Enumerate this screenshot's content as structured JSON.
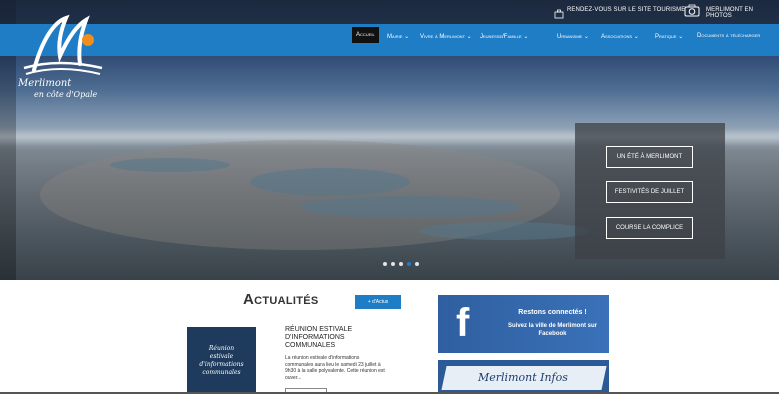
{
  "topbar": {
    "tourism_link": "RENDEZ-VOUS SUR LE SITE TOURISME",
    "photos_link": "MERLIMONT EN PHOTOS"
  },
  "logo": {
    "line1": "Merlimont",
    "line2": "en côte d'Opale"
  },
  "nav": {
    "items": [
      {
        "label": "Accueil"
      },
      {
        "label": "Mairie ⌄"
      },
      {
        "label": "Vivre à Merlimont ⌄"
      },
      {
        "label": "Jeunesse/Famille ⌄"
      },
      {
        "label": "Urbanisme ⌄"
      },
      {
        "label": "Associations ⌄"
      },
      {
        "label": "Pratique ⌄"
      },
      {
        "label": "Documents à télécharger"
      }
    ]
  },
  "hero": {
    "buttons": [
      {
        "label": "UN ÉTÉ À MERLIMONT"
      },
      {
        "label": "FESTIVITÉS DE JUILLET"
      },
      {
        "label": "COURSE LA COMPLICE"
      }
    ],
    "slide_count": 4,
    "active_slide": 4
  },
  "news": {
    "title": "Actualités",
    "more_label": "+ d'Actus",
    "item": {
      "thumb_lines": [
        "Réunion",
        "estivale",
        "d'informations",
        "communales"
      ],
      "headline": "RÉUNION ESTIVALE D'INFORMATIONS COMMUNALES",
      "excerpt": "La réunion estivale d'informations communales aura lieu le samedi 23 juillet à 9h30 à la salle polyvalente. Cette réunion est ouver..."
    }
  },
  "facebook": {
    "line1": "Restons connectés !",
    "line2": "Suivez la ville de Merlimont sur Facebook"
  },
  "infos": {
    "label": "Merlimont Infos"
  },
  "colors": {
    "brand_blue": "#1f7dc6",
    "facebook_blue": "#3a71b8"
  }
}
